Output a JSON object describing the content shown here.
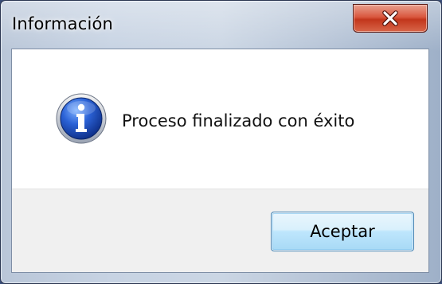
{
  "window": {
    "title": "Información",
    "close_icon": "close-icon"
  },
  "dialog": {
    "icon": "info-icon",
    "message": "Proceso finalizado con éxito",
    "ok_label": "Aceptar"
  },
  "colors": {
    "icon_blue": "#1f4fb8",
    "close_red": "#c2361c",
    "button_border": "#3c7fb1"
  }
}
